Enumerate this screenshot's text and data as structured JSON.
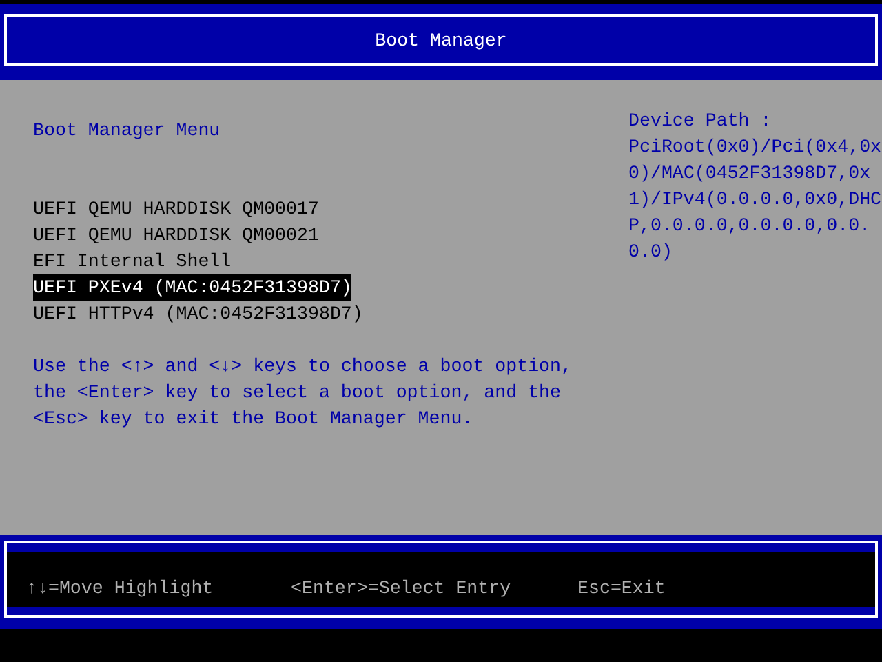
{
  "window": {
    "title": "Boot Manager"
  },
  "menu": {
    "title": "Boot Manager Menu",
    "items": [
      {
        "label": "UEFI QEMU HARDDISK QM00017",
        "selected": false
      },
      {
        "label": "UEFI QEMU HARDDISK QM00021",
        "selected": false
      },
      {
        "label": "EFI Internal Shell",
        "selected": false
      },
      {
        "label": "UEFI PXEv4 (MAC:0452F31398D7)",
        "selected": true
      },
      {
        "label": "UEFI HTTPv4 (MAC:0452F31398D7)",
        "selected": false
      }
    ],
    "help": [
      "Use the <↑> and <↓> keys to choose a boot option,",
      "the <Enter> key to select a boot option, and the",
      "<Esc> key to exit the Boot Manager Menu."
    ]
  },
  "device_path": {
    "label": "Device Path :",
    "value": "PciRoot(0x0)/Pci(0x4,0x0)/MAC(0452F31398D7,0x1)/IPv4(0.0.0.0,0x0,DHCP,0.0.0.0,0.0.0.0,0.0.0.0)"
  },
  "status_bar": [
    "↑↓=Move Highlight",
    "<Enter>=Select Entry",
    "Esc=Exit"
  ]
}
